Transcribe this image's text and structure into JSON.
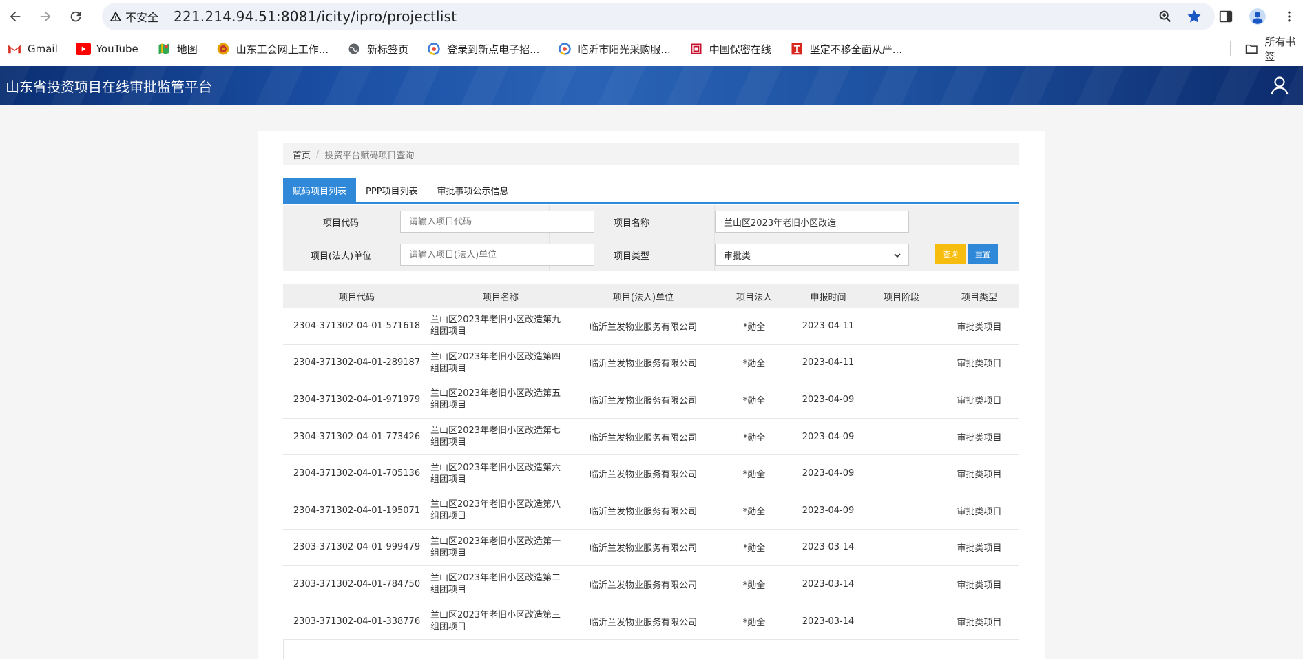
{
  "browser": {
    "security_label": "不安全",
    "url": "221.214.94.51:8081/icity/ipro/projectlist",
    "bookmarks": [
      {
        "label": "Gmail",
        "icon": "gmail-icon",
        "color": "#d93025"
      },
      {
        "label": "YouTube",
        "icon": "youtube-icon",
        "color": "#ff0000"
      },
      {
        "label": "地图",
        "icon": "maps-icon",
        "color": "#34a853"
      },
      {
        "label": "山东工会网上工作...",
        "icon": "union-icon",
        "color": "#e8a000"
      },
      {
        "label": "新标签页",
        "icon": "globe-icon",
        "color": "#5f6368"
      },
      {
        "label": "登录到新点电子招...",
        "icon": "xindian-icon",
        "color": "#3b7dd8"
      },
      {
        "label": "临沂市阳光采购服...",
        "icon": "linyi-icon",
        "color": "#3b7dd8"
      },
      {
        "label": "中国保密在线",
        "icon": "baomi-icon",
        "color": "#c8102e"
      },
      {
        "label": "坚定不移全面从严...",
        "icon": "party-icon",
        "color": "#d7261e"
      }
    ],
    "all_bookmarks": "所有书签"
  },
  "site": {
    "title": "山东省投资项目在线审批监管平台"
  },
  "breadcrumb": {
    "home": "首页",
    "separator": "/",
    "current": "投资平台赋码项目查询"
  },
  "tabs": [
    {
      "label": "赋码项目列表",
      "active": true
    },
    {
      "label": "PPP项目列表",
      "active": false
    },
    {
      "label": "审批事项公示信息",
      "active": false
    }
  ],
  "filter": {
    "code_label": "项目代码",
    "code_placeholder": "请输入项目代码",
    "name_label": "项目名称",
    "name_value": "兰山区2023年老旧小区改造",
    "unit_label": "项目(法人)单位",
    "unit_placeholder": "请输入项目(法人)单位",
    "type_label": "项目类型",
    "type_value": "审批类",
    "query_button": "查询",
    "reset_button": "重置"
  },
  "table": {
    "headers": [
      "项目代码",
      "项目名称",
      "项目(法人)单位",
      "项目法人",
      "申报时间",
      "项目阶段",
      "项目类型"
    ],
    "rows": [
      {
        "code": "2304-371302-04-01-571618",
        "name": "兰山区2023年老旧小区改造第九组团项目",
        "unit": "临沂兰发物业服务有限公司",
        "person": "*勋全",
        "date": "2023-04-11",
        "stage": "",
        "type": "审批类项目"
      },
      {
        "code": "2304-371302-04-01-289187",
        "name": "兰山区2023年老旧小区改造第四组团项目",
        "unit": "临沂兰发物业服务有限公司",
        "person": "*勋全",
        "date": "2023-04-11",
        "stage": "",
        "type": "审批类项目"
      },
      {
        "code": "2304-371302-04-01-971979",
        "name": "兰山区2023年老旧小区改造第五组团项目",
        "unit": "临沂兰发物业服务有限公司",
        "person": "*勋全",
        "date": "2023-04-09",
        "stage": "",
        "type": "审批类项目"
      },
      {
        "code": "2304-371302-04-01-773426",
        "name": "兰山区2023年老旧小区改造第七组团项目",
        "unit": "临沂兰发物业服务有限公司",
        "person": "*勋全",
        "date": "2023-04-09",
        "stage": "",
        "type": "审批类项目"
      },
      {
        "code": "2304-371302-04-01-705136",
        "name": "兰山区2023年老旧小区改造第六组团项目",
        "unit": "临沂兰发物业服务有限公司",
        "person": "*勋全",
        "date": "2023-04-09",
        "stage": "",
        "type": "审批类项目"
      },
      {
        "code": "2304-371302-04-01-195071",
        "name": "兰山区2023年老旧小区改造第八组团项目",
        "unit": "临沂兰发物业服务有限公司",
        "person": "*勋全",
        "date": "2023-04-09",
        "stage": "",
        "type": "审批类项目"
      },
      {
        "code": "2303-371302-04-01-999479",
        "name": "兰山区2023年老旧小区改造第一组团项目",
        "unit": "临沂兰发物业服务有限公司",
        "person": "*勋全",
        "date": "2023-03-14",
        "stage": "",
        "type": "审批类项目"
      },
      {
        "code": "2303-371302-04-01-784750",
        "name": "兰山区2023年老旧小区改造第二组团项目",
        "unit": "临沂兰发物业服务有限公司",
        "person": "*勋全",
        "date": "2023-03-14",
        "stage": "",
        "type": "审批类项目"
      },
      {
        "code": "2303-371302-04-01-338776",
        "name": "兰山区2023年老旧小区改造第三组团项目",
        "unit": "临沂兰发物业服务有限公司",
        "person": "*勋全",
        "date": "2023-03-14",
        "stage": "",
        "type": "审批类项目"
      }
    ]
  }
}
